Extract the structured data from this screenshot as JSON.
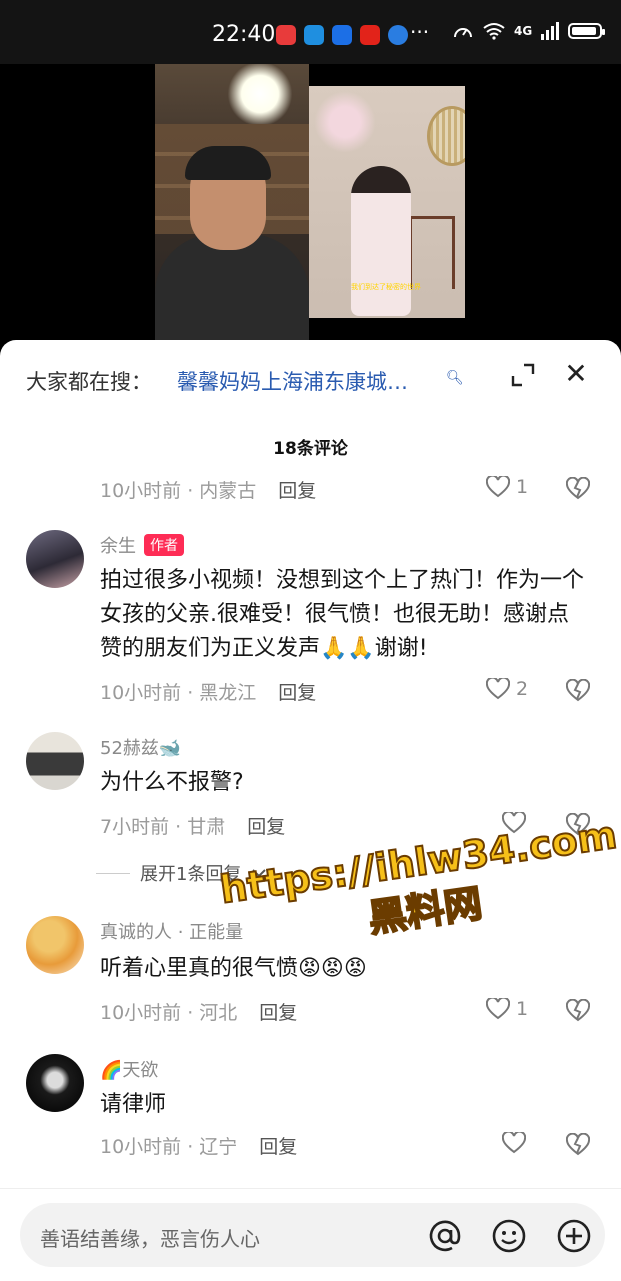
{
  "status": {
    "time": "22:40",
    "network": "4G",
    "more": "···"
  },
  "video": {
    "caption": "我们到达了秘密的世界"
  },
  "search": {
    "prefix": "大家都在搜：",
    "query": "馨馨妈妈上海浦东康城…"
  },
  "comments_count": "18条评论",
  "first_meta": {
    "time_location": "10小时前 · 内蒙古",
    "reply": "回复",
    "likes": "1"
  },
  "comments": [
    {
      "name": "余生",
      "badge": "作者",
      "text": "拍过很多小视频！没想到这个上了热门！作为一个女孩的父亲.很难受！很气愤！也很无助！感谢点赞的朋友们为正义发声🙏🙏谢谢!",
      "time_location": "10小时前 · 黑龙江",
      "reply": "回复",
      "likes": "2"
    },
    {
      "name": "52赫兹🐋",
      "text": "为什么不报警?",
      "time_location": "7小时前 · 甘肃",
      "reply": "回复",
      "likes": ""
    },
    {
      "name": "真诚的人 · 正能量",
      "text": "听着心里真的很气愤😡😡😡",
      "time_location": "10小时前 · 河北",
      "reply": "回复",
      "likes": "1"
    },
    {
      "name": "🌈天欲",
      "text": "请律师",
      "time_location": "10小时前 · 辽宁",
      "reply": "回复",
      "likes": ""
    }
  ],
  "expand_label": "展开1条回复",
  "watermark": {
    "line1": "https://ihlw34.com",
    "line2": "黑料网"
  },
  "input": {
    "placeholder": "善语结善缘，恶言伤人心"
  }
}
